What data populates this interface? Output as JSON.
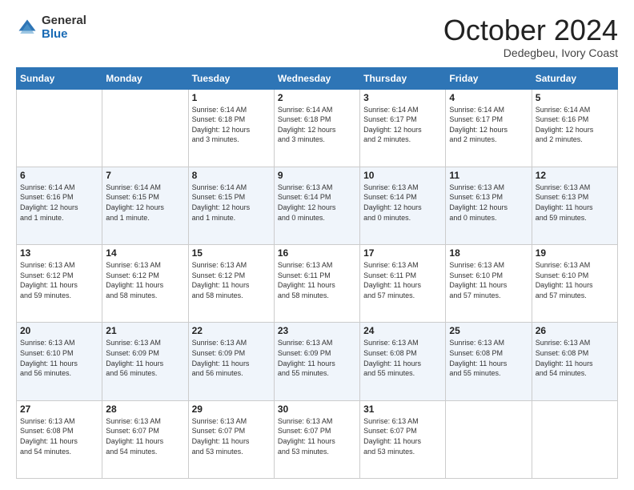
{
  "logo": {
    "general": "General",
    "blue": "Blue"
  },
  "header": {
    "month": "October 2024",
    "location": "Dedegbeu, Ivory Coast"
  },
  "weekdays": [
    "Sunday",
    "Monday",
    "Tuesday",
    "Wednesday",
    "Thursday",
    "Friday",
    "Saturday"
  ],
  "weeks": [
    [
      {
        "day": null,
        "info": ""
      },
      {
        "day": null,
        "info": ""
      },
      {
        "day": "1",
        "info": "Sunrise: 6:14 AM\nSunset: 6:18 PM\nDaylight: 12 hours\nand 3 minutes."
      },
      {
        "day": "2",
        "info": "Sunrise: 6:14 AM\nSunset: 6:18 PM\nDaylight: 12 hours\nand 3 minutes."
      },
      {
        "day": "3",
        "info": "Sunrise: 6:14 AM\nSunset: 6:17 PM\nDaylight: 12 hours\nand 2 minutes."
      },
      {
        "day": "4",
        "info": "Sunrise: 6:14 AM\nSunset: 6:17 PM\nDaylight: 12 hours\nand 2 minutes."
      },
      {
        "day": "5",
        "info": "Sunrise: 6:14 AM\nSunset: 6:16 PM\nDaylight: 12 hours\nand 2 minutes."
      }
    ],
    [
      {
        "day": "6",
        "info": "Sunrise: 6:14 AM\nSunset: 6:16 PM\nDaylight: 12 hours\nand 1 minute."
      },
      {
        "day": "7",
        "info": "Sunrise: 6:14 AM\nSunset: 6:15 PM\nDaylight: 12 hours\nand 1 minute."
      },
      {
        "day": "8",
        "info": "Sunrise: 6:14 AM\nSunset: 6:15 PM\nDaylight: 12 hours\nand 1 minute."
      },
      {
        "day": "9",
        "info": "Sunrise: 6:13 AM\nSunset: 6:14 PM\nDaylight: 12 hours\nand 0 minutes."
      },
      {
        "day": "10",
        "info": "Sunrise: 6:13 AM\nSunset: 6:14 PM\nDaylight: 12 hours\nand 0 minutes."
      },
      {
        "day": "11",
        "info": "Sunrise: 6:13 AM\nSunset: 6:13 PM\nDaylight: 12 hours\nand 0 minutes."
      },
      {
        "day": "12",
        "info": "Sunrise: 6:13 AM\nSunset: 6:13 PM\nDaylight: 11 hours\nand 59 minutes."
      }
    ],
    [
      {
        "day": "13",
        "info": "Sunrise: 6:13 AM\nSunset: 6:12 PM\nDaylight: 11 hours\nand 59 minutes."
      },
      {
        "day": "14",
        "info": "Sunrise: 6:13 AM\nSunset: 6:12 PM\nDaylight: 11 hours\nand 58 minutes."
      },
      {
        "day": "15",
        "info": "Sunrise: 6:13 AM\nSunset: 6:12 PM\nDaylight: 11 hours\nand 58 minutes."
      },
      {
        "day": "16",
        "info": "Sunrise: 6:13 AM\nSunset: 6:11 PM\nDaylight: 11 hours\nand 58 minutes."
      },
      {
        "day": "17",
        "info": "Sunrise: 6:13 AM\nSunset: 6:11 PM\nDaylight: 11 hours\nand 57 minutes."
      },
      {
        "day": "18",
        "info": "Sunrise: 6:13 AM\nSunset: 6:10 PM\nDaylight: 11 hours\nand 57 minutes."
      },
      {
        "day": "19",
        "info": "Sunrise: 6:13 AM\nSunset: 6:10 PM\nDaylight: 11 hours\nand 57 minutes."
      }
    ],
    [
      {
        "day": "20",
        "info": "Sunrise: 6:13 AM\nSunset: 6:10 PM\nDaylight: 11 hours\nand 56 minutes."
      },
      {
        "day": "21",
        "info": "Sunrise: 6:13 AM\nSunset: 6:09 PM\nDaylight: 11 hours\nand 56 minutes."
      },
      {
        "day": "22",
        "info": "Sunrise: 6:13 AM\nSunset: 6:09 PM\nDaylight: 11 hours\nand 56 minutes."
      },
      {
        "day": "23",
        "info": "Sunrise: 6:13 AM\nSunset: 6:09 PM\nDaylight: 11 hours\nand 55 minutes."
      },
      {
        "day": "24",
        "info": "Sunrise: 6:13 AM\nSunset: 6:08 PM\nDaylight: 11 hours\nand 55 minutes."
      },
      {
        "day": "25",
        "info": "Sunrise: 6:13 AM\nSunset: 6:08 PM\nDaylight: 11 hours\nand 55 minutes."
      },
      {
        "day": "26",
        "info": "Sunrise: 6:13 AM\nSunset: 6:08 PM\nDaylight: 11 hours\nand 54 minutes."
      }
    ],
    [
      {
        "day": "27",
        "info": "Sunrise: 6:13 AM\nSunset: 6:08 PM\nDaylight: 11 hours\nand 54 minutes."
      },
      {
        "day": "28",
        "info": "Sunrise: 6:13 AM\nSunset: 6:07 PM\nDaylight: 11 hours\nand 54 minutes."
      },
      {
        "day": "29",
        "info": "Sunrise: 6:13 AM\nSunset: 6:07 PM\nDaylight: 11 hours\nand 53 minutes."
      },
      {
        "day": "30",
        "info": "Sunrise: 6:13 AM\nSunset: 6:07 PM\nDaylight: 11 hours\nand 53 minutes."
      },
      {
        "day": "31",
        "info": "Sunrise: 6:13 AM\nSunset: 6:07 PM\nDaylight: 11 hours\nand 53 minutes."
      },
      {
        "day": null,
        "info": ""
      },
      {
        "day": null,
        "info": ""
      }
    ]
  ]
}
